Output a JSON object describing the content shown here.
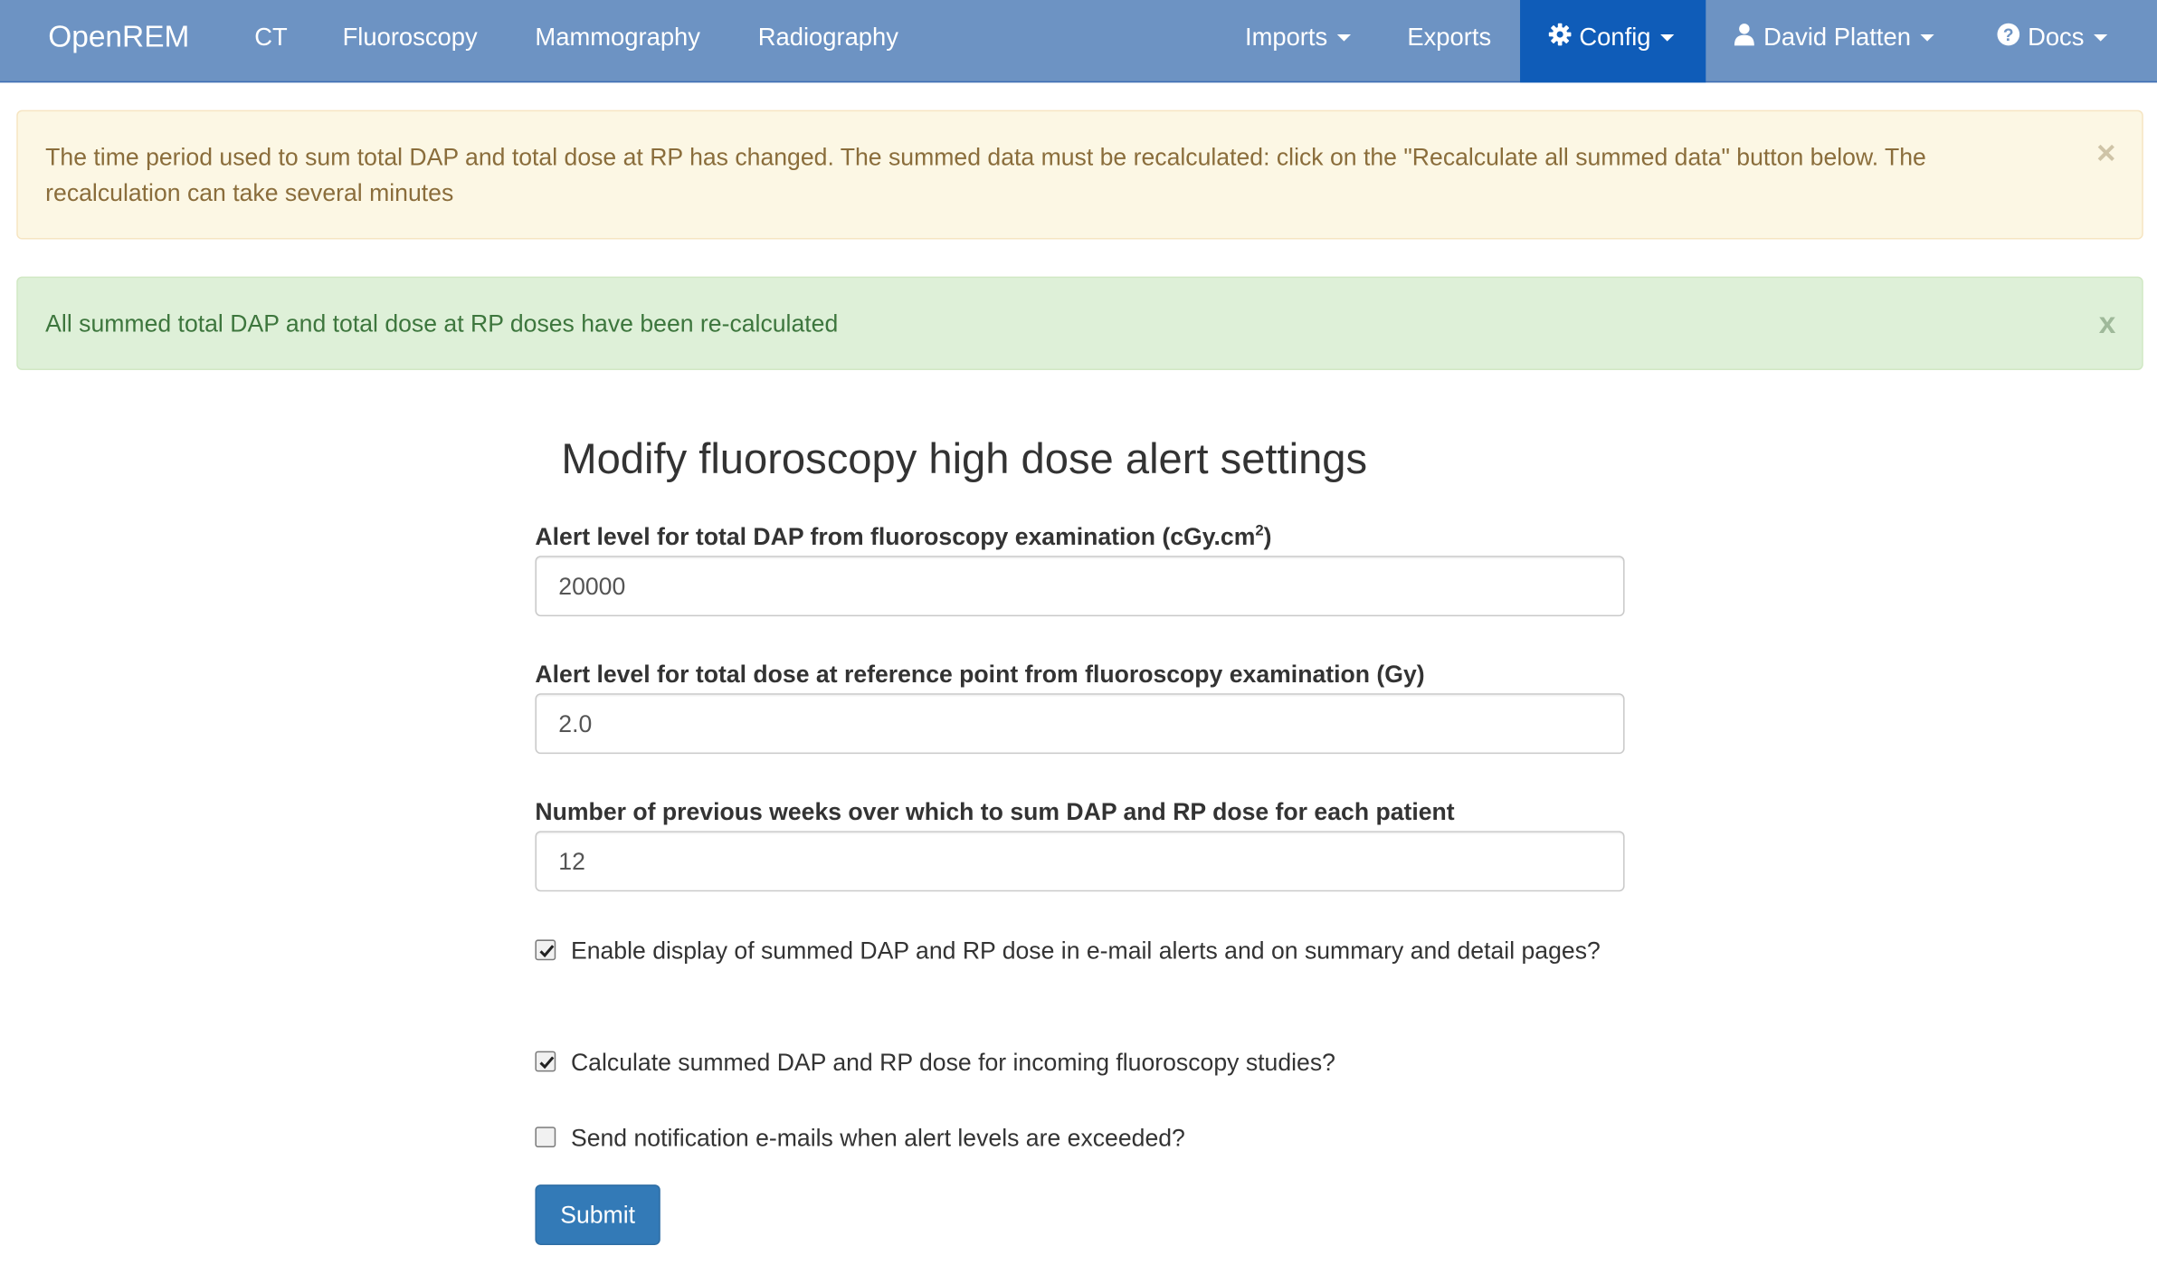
{
  "navbar": {
    "brand": "OpenREM",
    "links": [
      "CT",
      "Fluoroscopy",
      "Mammography",
      "Radiography"
    ],
    "imports": "Imports",
    "exports": "Exports",
    "config": "Config",
    "user": "David Platten",
    "docs": "Docs",
    "icons": {
      "config": "gear-icon",
      "user": "user-icon",
      "docs": "question-circle-icon"
    }
  },
  "alerts": {
    "warning": "The time period used to sum total DAP and total dose at RP has changed. The summed data must be recalculated: click on the \"Recalculate all summed data\" button below. The recalculation can take several minutes",
    "warning_close": "×",
    "success": "All summed total DAP and total dose at RP doses have been re-calculated",
    "success_close": "x"
  },
  "form": {
    "title": "Modify fluoroscopy high dose alert settings",
    "dap_label": "Alert level for total DAP from fluoroscopy examination (cGy.cm",
    "dap_label_sup": "2",
    "dap_label_end": ")",
    "dap_value": "20000",
    "rp_label": "Alert level for total dose at reference point from fluoroscopy examination (Gy)",
    "rp_value": "2.0",
    "weeks_label": "Number of previous weeks over which to sum DAP and RP dose for each patient",
    "weeks_value": "12",
    "checks": [
      {
        "label": "Enable display of summed DAP and RP dose in e-mail alerts and on summary and detail pages?",
        "checked": true
      },
      {
        "label": "Calculate summed DAP and RP dose for incoming fluoroscopy studies?",
        "checked": true
      },
      {
        "label": "Send notification e-mails when alert levels are exceeded?",
        "checked": false
      }
    ],
    "submit": "Submit"
  },
  "colors": {
    "navbar": "#6d93c3",
    "navbar_active": "#0f5cb8",
    "warning_bg": "#fcf7e4",
    "success_bg": "#def0d8",
    "primary_button": "#337ab7"
  }
}
